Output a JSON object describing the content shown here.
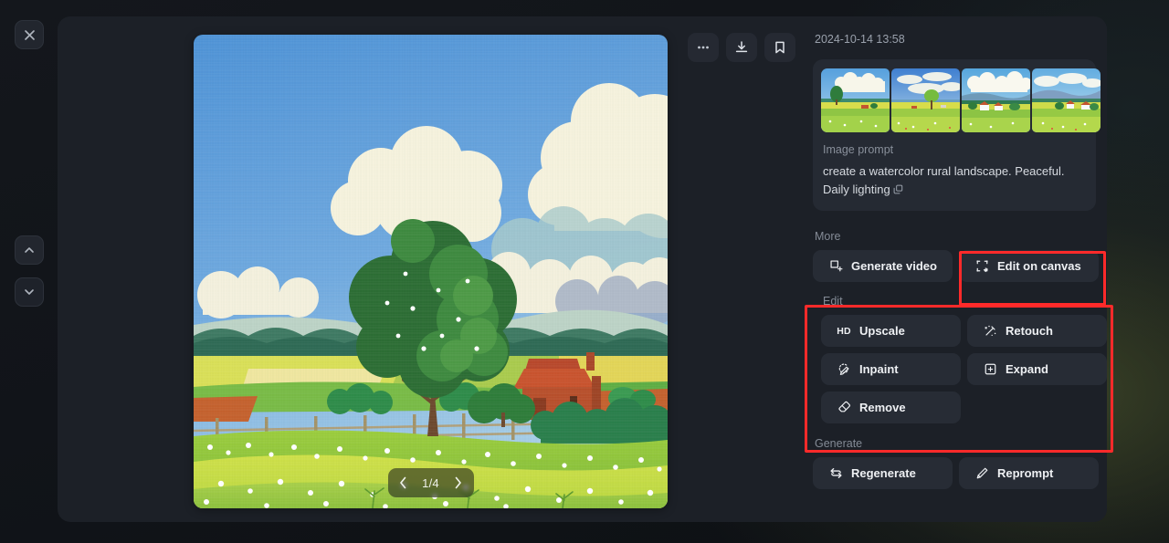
{
  "window": {
    "close_label": "Close",
    "prev_label": "Previous image",
    "next_label": "Next image"
  },
  "toolbar": {
    "more_label": "More options",
    "download_label": "Download",
    "bookmark_label": "Bookmark"
  },
  "stage": {
    "pager_label": "1/4",
    "pager_prev": "‹",
    "pager_next": "›",
    "current_index": 1,
    "total": 4
  },
  "panel": {
    "timestamp": "2024-10-14 13:58",
    "prompt_label": "Image prompt",
    "prompt_text": "create a watercolor rural landscape. Peaceful. Daily lighting",
    "copy_icon": "copy-icon",
    "thumbnails": [
      {
        "alt": "watercolor landscape variation 1"
      },
      {
        "alt": "watercolor landscape variation 2"
      },
      {
        "alt": "watercolor landscape variation 3"
      },
      {
        "alt": "watercolor landscape variation 4"
      }
    ],
    "sections": {
      "more": {
        "label": "More",
        "buttons": [
          {
            "label": "Generate video",
            "icon": "video-frame-icon"
          },
          {
            "label": "Edit on canvas",
            "icon": "canvas-crop-icon"
          }
        ]
      },
      "edit": {
        "label": "Edit",
        "buttons": [
          {
            "label": "Upscale",
            "icon": "hd-icon"
          },
          {
            "label": "Retouch",
            "icon": "magic-wand-icon"
          },
          {
            "label": "Inpaint",
            "icon": "inpaint-brush-icon"
          },
          {
            "label": "Expand",
            "icon": "expand-frame-icon"
          },
          {
            "label": "Remove",
            "icon": "eraser-icon"
          }
        ]
      },
      "generate": {
        "label": "Generate",
        "buttons": [
          {
            "label": "Regenerate",
            "icon": "refresh-arrows-icon"
          },
          {
            "label": "Reprompt",
            "icon": "pencil-icon"
          }
        ]
      }
    }
  },
  "highlights": {
    "accent_color": "#ff2a2a",
    "items": [
      {
        "target": "Edit on canvas"
      },
      {
        "target": "Edit section"
      }
    ]
  },
  "colors": {
    "modal_bg": "#1c2027",
    "card_bg": "#252a33",
    "button_bg": "#272c35",
    "text_primary": "#eef0f3",
    "text_muted": "#888f9a",
    "highlight": "#ff2a2a"
  }
}
